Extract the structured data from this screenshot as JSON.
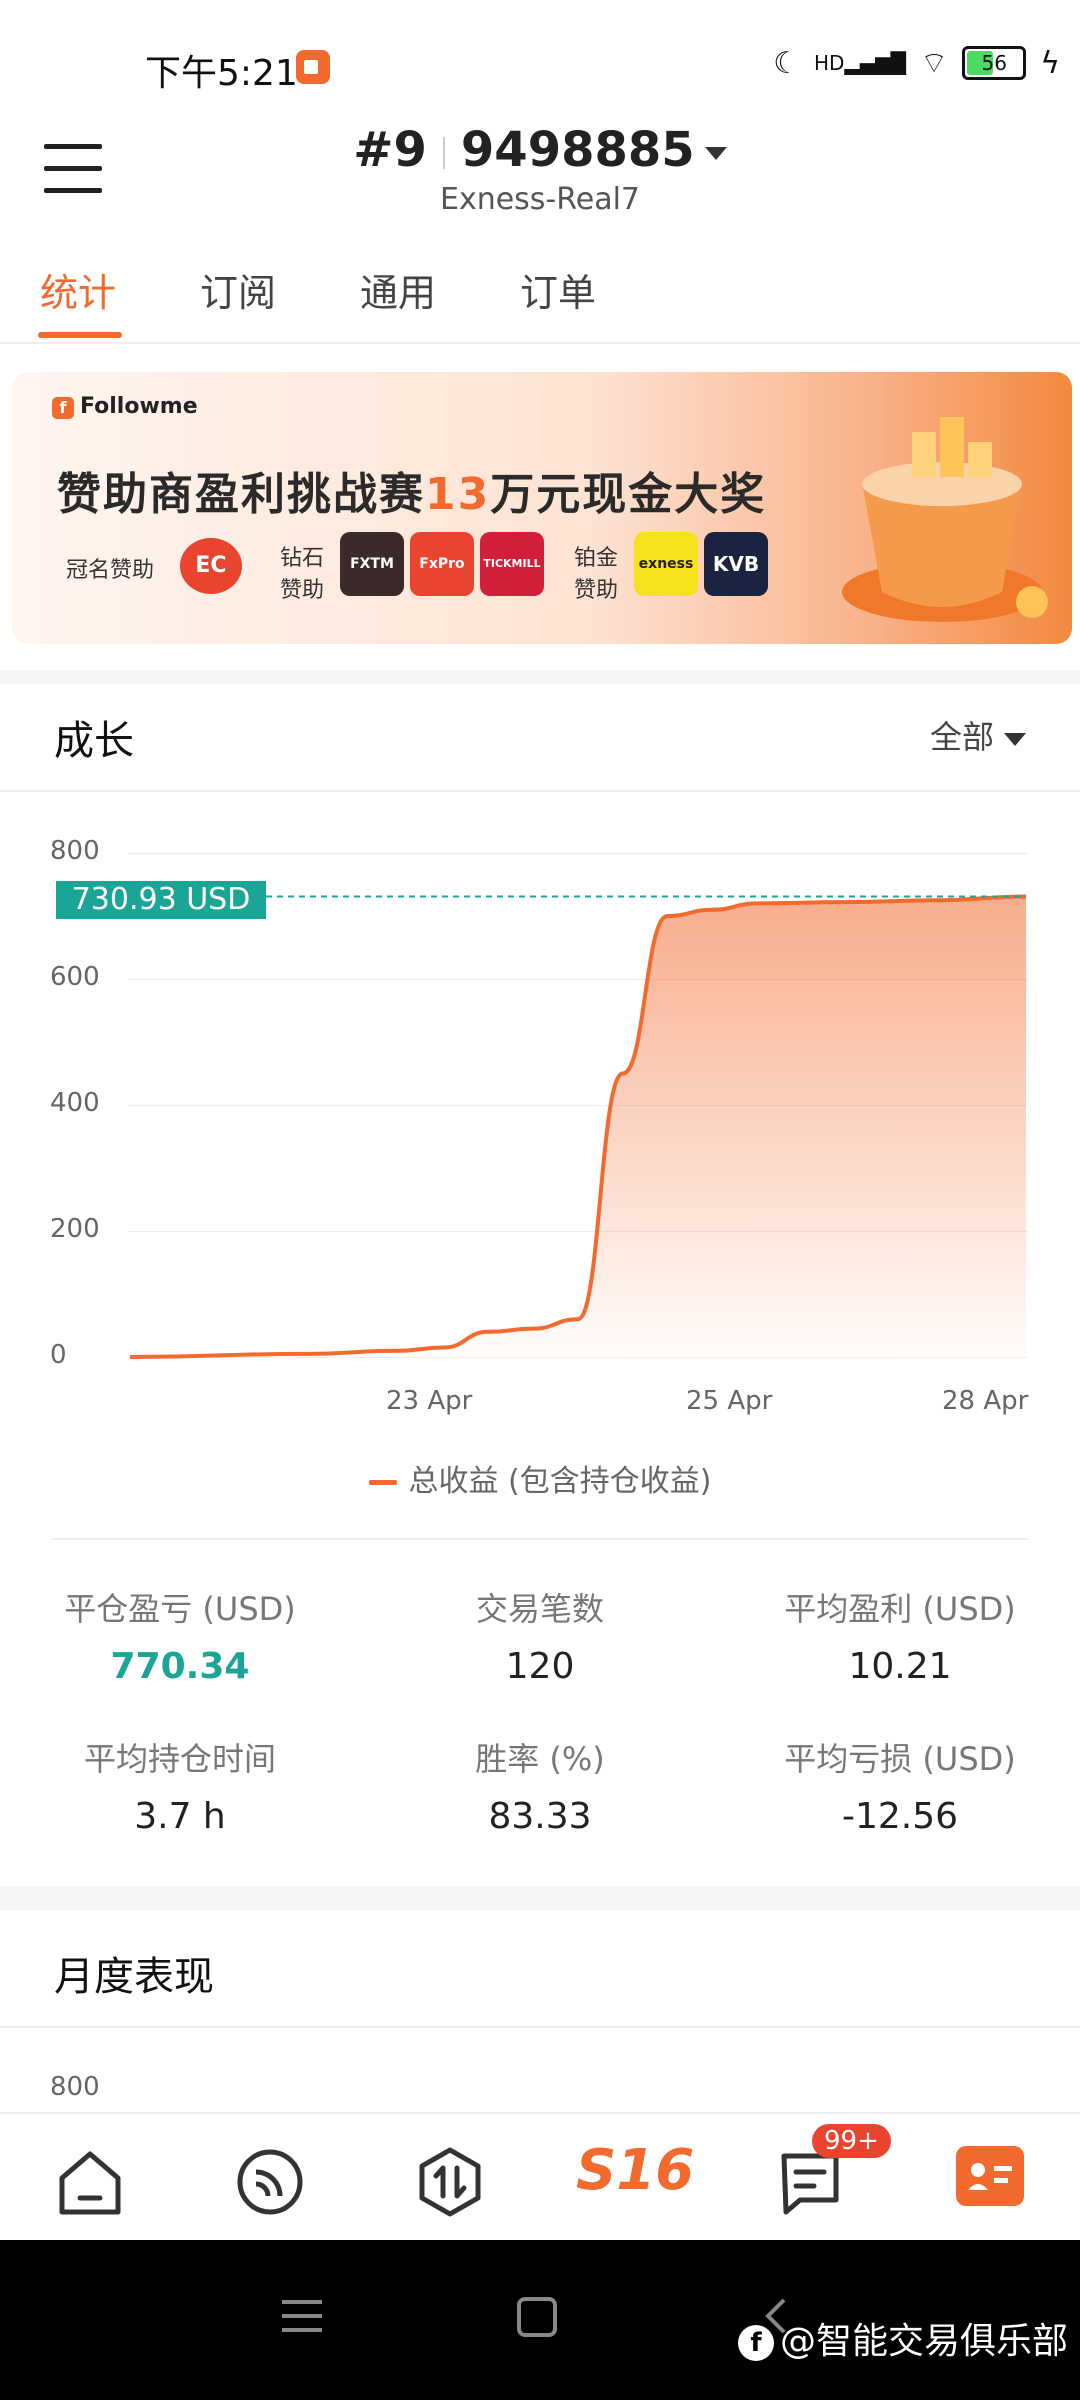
{
  "status_bar": {
    "time": "下午5:21",
    "network": "HD",
    "battery": "56"
  },
  "header": {
    "rank": "#9",
    "account_number": "9498885",
    "server": "Exness-Real7"
  },
  "tabs": [
    {
      "label": "统计",
      "active": true
    },
    {
      "label": "订阅",
      "active": false
    },
    {
      "label": "通用",
      "active": false
    },
    {
      "label": "订单",
      "active": false
    }
  ],
  "banner": {
    "brand": "Followme",
    "headline_a": "赞助商盈利挑战赛",
    "headline_num": "13",
    "headline_b": "万元现金大奖",
    "title_sponsor_label": "冠名赞助",
    "title_sponsor_logo": "EC",
    "diamond_label_1": "钻石",
    "diamond_label_2": "赞助",
    "diamond_logos": [
      "FXTM",
      "FxPro",
      "TICKMILL"
    ],
    "platinum_label_1": "铂金",
    "platinum_label_2": "赞助",
    "platinum_logos": [
      "exness",
      "KVB"
    ]
  },
  "growth": {
    "title": "成长",
    "filter": "全部",
    "current_value_tag": "730.93 USD",
    "legend": "总收益 (包含持仓收益)"
  },
  "chart_data": {
    "type": "area",
    "yticks": [
      "800",
      "600",
      "400",
      "200",
      "0"
    ],
    "ylim": [
      0,
      800
    ],
    "xticks": [
      "23 Apr",
      "25 Apr",
      "28 Apr"
    ],
    "series": [
      {
        "name": "总收益 (包含持仓收益)",
        "x": [
          0,
          0.2,
          0.3,
          0.35,
          0.4,
          0.45,
          0.5,
          0.55,
          0.6,
          0.65,
          0.7,
          0.8,
          0.9,
          1.0
        ],
        "values": [
          0,
          5,
          10,
          15,
          40,
          45,
          60,
          450,
          700,
          710,
          720,
          722,
          725,
          730.93
        ]
      }
    ]
  },
  "stats": [
    {
      "label": "平仓盈亏 (USD)",
      "value": "770.34"
    },
    {
      "label": "交易笔数",
      "value": "120"
    },
    {
      "label": "平均盈利 (USD)",
      "value": "10.21"
    },
    {
      "label": "平均持仓时间",
      "value": "3.7 h"
    },
    {
      "label": "胜率 (%)",
      "value": "83.33"
    },
    {
      "label": "平均亏损 (USD)",
      "value": "-12.56"
    }
  ],
  "monthly": {
    "title": "月度表现",
    "ytick_top": "800"
  },
  "bottom_nav": {
    "center_label": "S16",
    "message_badge": "99+"
  },
  "watermark": "@智能交易俱乐部",
  "colors": {
    "accent": "#f26a2e",
    "teal": "#1aa597"
  }
}
